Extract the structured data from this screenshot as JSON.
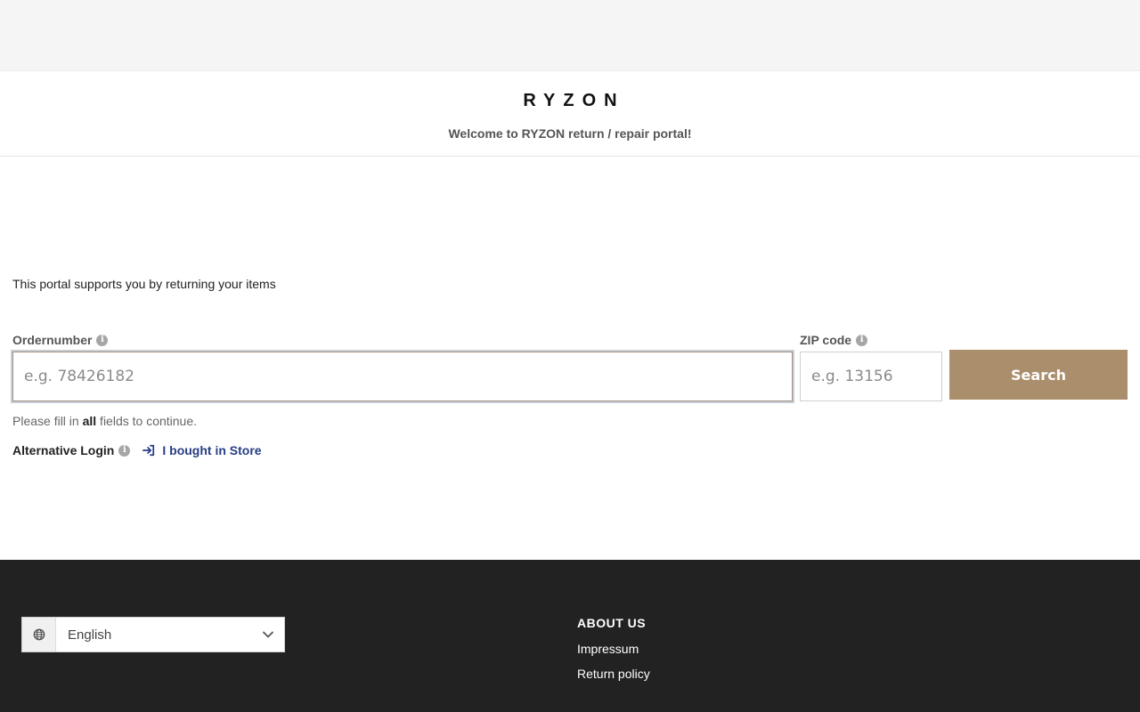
{
  "header": {
    "logo_text": "RYZON",
    "welcome": "Welcome to RYZON return / repair portal!"
  },
  "main": {
    "intro": "This portal supports you by returning your items",
    "order": {
      "label": "Ordernumber",
      "placeholder": "e.g. 78426182",
      "value": ""
    },
    "zip": {
      "label": "ZIP code",
      "placeholder": "e.g. 13156",
      "value": ""
    },
    "search_label": "Search",
    "hint": {
      "before": "Please fill in ",
      "bold": "all",
      "after": " fields to continue."
    },
    "alt_login": {
      "label": "Alternative Login",
      "link": "I bought in Store"
    }
  },
  "footer": {
    "language": {
      "selected": "English"
    },
    "about": {
      "title": "ABOUT US",
      "links": [
        "Impressum",
        "Return policy"
      ]
    }
  },
  "colors": {
    "accent": "#ab8e6c",
    "link": "#263d86",
    "footer_bg": "#222222",
    "top_strip": "#f5f5f5"
  },
  "icons": {
    "info": "info-icon",
    "login": "login-arrow-icon",
    "globe": "globe-icon",
    "chevron": "chevron-down-icon"
  }
}
